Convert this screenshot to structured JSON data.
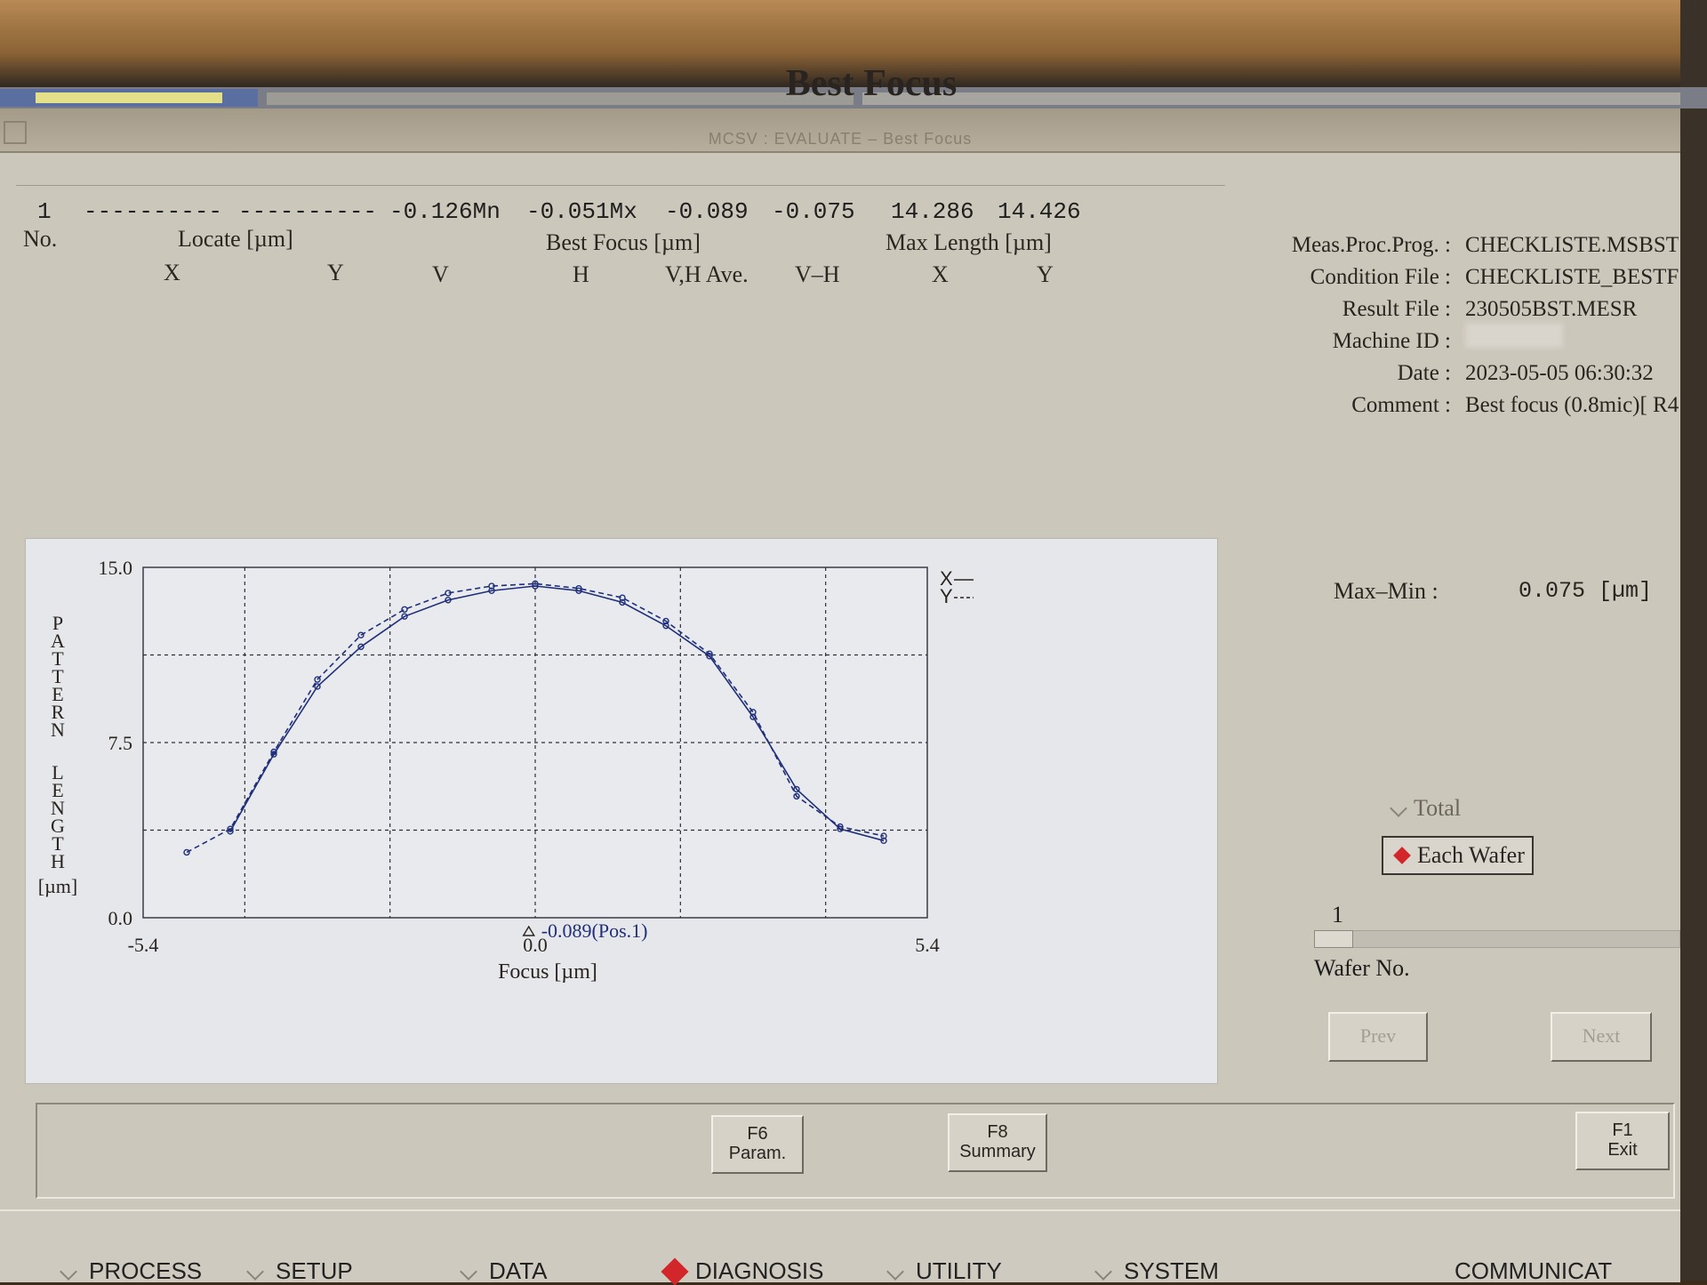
{
  "window": {
    "title": "MCSV : EVALUATE – Best Focus"
  },
  "page_title": "Best Focus",
  "table": {
    "headers": {
      "no": "No.",
      "locate": "Locate [µm]",
      "best_focus": "Best Focus [µm]",
      "max_length": "Max Length [µm]",
      "x": "X",
      "y": "Y",
      "v": "V",
      "h": "H",
      "vh_ave": "V,H Ave.",
      "v_minus_h": "V–H",
      "ml_x": "X",
      "ml_y": "Y"
    },
    "rows": [
      {
        "no": "1",
        "locate_x": "----------",
        "locate_y": "----------",
        "v": "-0.126Mn",
        "h": "-0.051Mx",
        "vh_ave": "-0.089",
        "v_minus_h": "-0.075",
        "max_x": "14.286",
        "max_y": "14.426"
      }
    ]
  },
  "info": {
    "meas_proc_prog_label": "Meas.Proc.Prog. :",
    "meas_proc_prog_value": "CHECKLISTE.MSBST",
    "condition_file_label": "Condition File :",
    "condition_file_value": "CHECKLISTE_BESTF",
    "result_file_label": "Result File :",
    "result_file_value": "230505BST.MESR",
    "machine_id_label": "Machine ID :",
    "date_label": "Date :",
    "date_value": "2023-05-05 06:30:32",
    "comment_label": "Comment :",
    "comment_value": "Best focus (0.8mic)[ R4"
  },
  "summary": {
    "label": "Max–Min :",
    "value": "0.075 [µm]"
  },
  "view_mode": {
    "options": [
      "Total",
      "Each Wafer"
    ],
    "selected": "Each Wafer"
  },
  "wafer": {
    "value": "1",
    "label": "Wafer No."
  },
  "nav": {
    "prev": "Prev",
    "next": "Next"
  },
  "function_keys": [
    {
      "key": "F6",
      "label": "Param."
    },
    {
      "key": "F8",
      "label": "Summary"
    },
    {
      "key": "F1",
      "label": "Exit"
    }
  ],
  "menu": [
    {
      "label": "PROCESS",
      "active": false
    },
    {
      "label": "SETUP",
      "active": false
    },
    {
      "label": "DATA",
      "active": false
    },
    {
      "label": "DIAGNOSIS",
      "active": true
    },
    {
      "label": "UTILITY",
      "active": false
    },
    {
      "label": "SYSTEM",
      "active": false
    },
    {
      "label": "COMMUNICAT",
      "active": false
    }
  ],
  "colors": {
    "accent_red": "#d2262a",
    "plot_line": "#1f2f7a",
    "screen_bg": "#d4d0c6"
  },
  "chart_data": {
    "type": "line",
    "xlabel": "Focus [µm]",
    "ylabel": "PATTERN LENGTH [µm]",
    "xlim": [
      -5.4,
      5.4
    ],
    "ylim": [
      0.0,
      15.0
    ],
    "x_ticks": [
      "-5.4",
      "0.0",
      "5.4"
    ],
    "y_ticks": [
      "15.0",
      "7.5",
      "0.0"
    ],
    "grid": true,
    "legend_position": "top-right",
    "marker_text": "-0.089(Pos.1)",
    "marker_x": -0.089,
    "series": [
      {
        "name": "X",
        "style": "solid",
        "x": [
          -4.2,
          -3.6,
          -3.0,
          -2.4,
          -1.8,
          -1.2,
          -0.6,
          0.0,
          0.6,
          1.2,
          1.8,
          2.4,
          3.0,
          3.6,
          4.2,
          4.8
        ],
        "y": [
          3.7,
          7.0,
          9.9,
          11.6,
          12.9,
          13.6,
          14.0,
          14.2,
          14.0,
          13.5,
          12.5,
          11.2,
          8.6,
          5.5,
          3.8,
          3.3
        ]
      },
      {
        "name": "Y",
        "style": "dashed",
        "x": [
          -4.8,
          -4.2,
          -3.6,
          -3.0,
          -2.4,
          -1.8,
          -1.2,
          -0.6,
          0.0,
          0.6,
          1.2,
          1.8,
          2.4,
          3.0,
          3.6,
          4.2,
          4.8
        ],
        "y": [
          2.8,
          3.8,
          7.1,
          10.2,
          12.1,
          13.2,
          13.9,
          14.2,
          14.3,
          14.1,
          13.7,
          12.7,
          11.3,
          8.8,
          5.2,
          3.9,
          3.5
        ]
      }
    ]
  }
}
